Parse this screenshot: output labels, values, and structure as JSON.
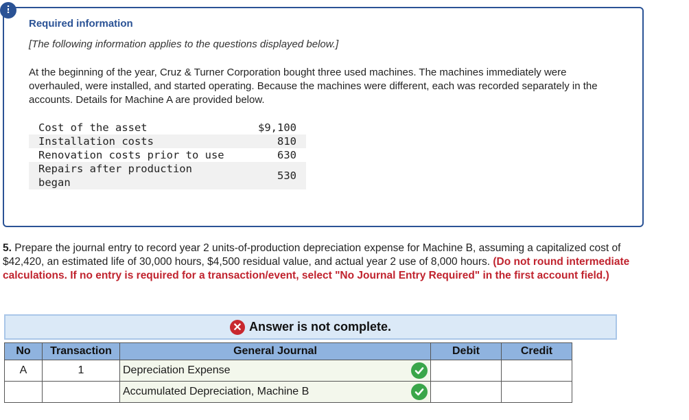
{
  "alert_icon": "!",
  "info": {
    "title": "Required information",
    "subtitle": "[The following information applies to the questions displayed below.]",
    "paragraph": "At the beginning of the year, Cruz & Turner Corporation bought three used machines. The machines immediately were overhauled, were installed, and started operating. Because the machines were different, each was recorded separately in the accounts. Details for Machine A are provided below.",
    "details": [
      {
        "label": "Cost of the asset",
        "amount": "$9,100"
      },
      {
        "label": "Installation costs",
        "amount": "810"
      },
      {
        "label": "Renovation costs prior to use",
        "amount": "630"
      },
      {
        "label": "Repairs after production began",
        "amount": "530"
      }
    ]
  },
  "question": {
    "number": "5.",
    "text": "Prepare the journal entry to record year 2 units-of-production depreciation expense for Machine B, assuming a capitalized cost of $42,420, an estimated life of 30,000 hours, $4,500 residual value, and actual year 2 use of 8,000 hours.",
    "instruction": "(Do not round intermediate calculations. If no entry is required for a transaction/event, select \"No Journal Entry Required\" in the first account field.)"
  },
  "answer_banner": {
    "icon": "x-circle-icon",
    "text": "Answer is not complete."
  },
  "journal": {
    "headers": {
      "no": "No",
      "transaction": "Transaction",
      "general_journal": "General Journal",
      "debit": "Debit",
      "credit": "Credit"
    },
    "rows": [
      {
        "no": "A",
        "transaction": "1",
        "account": "Depreciation Expense",
        "debit": "",
        "credit": "",
        "status": "check-icon"
      },
      {
        "no": "",
        "transaction": "",
        "account": "Accumulated Depreciation, Machine B",
        "debit": "",
        "credit": "",
        "status": "check-icon"
      }
    ]
  },
  "colors": {
    "accent": "#2a5295",
    "instruction_red": "#c0232e",
    "header_blue": "#8fb3df",
    "banner_bg": "#dbe9f7",
    "check_green": "#3aa64a",
    "x_red": "#c8282f"
  }
}
